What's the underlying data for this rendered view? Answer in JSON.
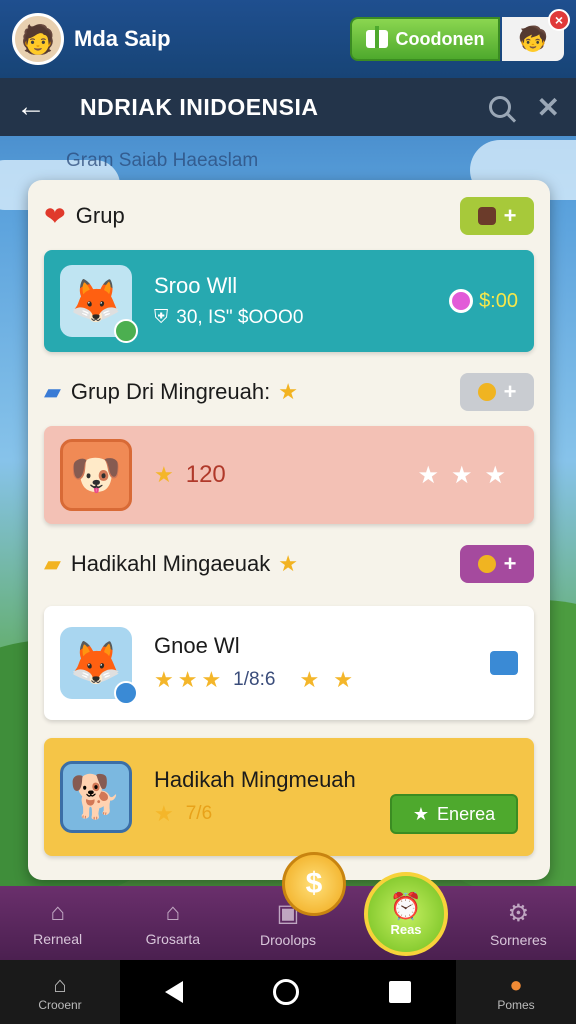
{
  "header": {
    "username": "Mda Saip",
    "action_label": "Coodonen",
    "badge": "×"
  },
  "nav": {
    "title": "NDRIAK INIDOENSIA"
  },
  "caption": "Gram Saiab Haeaslam",
  "sections": [
    {
      "title": "Grup"
    },
    {
      "title": "Grup Dri Mingreuah:"
    },
    {
      "title": "Hadikahl Mingaeuak"
    }
  ],
  "cards": [
    {
      "name": "Sroo Wll",
      "stat": "30, IS\" $OOO0",
      "reward": "$:00"
    },
    {
      "value": "120"
    },
    {
      "name": "Gnoe Wl",
      "progress": "1/8:6"
    },
    {
      "name": "Hadikah Mingmeuah",
      "score": "7/6",
      "button_label": "Enerea"
    }
  ],
  "bottom_nav": {
    "tabs": [
      "Rerneal",
      "Grosarta",
      "Droolops",
      "",
      "Sorneres"
    ],
    "fab_label": "Reas"
  },
  "system_bar": {
    "left_label": "Crooenr",
    "right_label": "Pomes"
  },
  "colors": {
    "teal_card": "#27a9b0",
    "pink_card": "#f3c1b5",
    "yellow_card": "#f5c547",
    "green_button": "#4ea92d"
  }
}
